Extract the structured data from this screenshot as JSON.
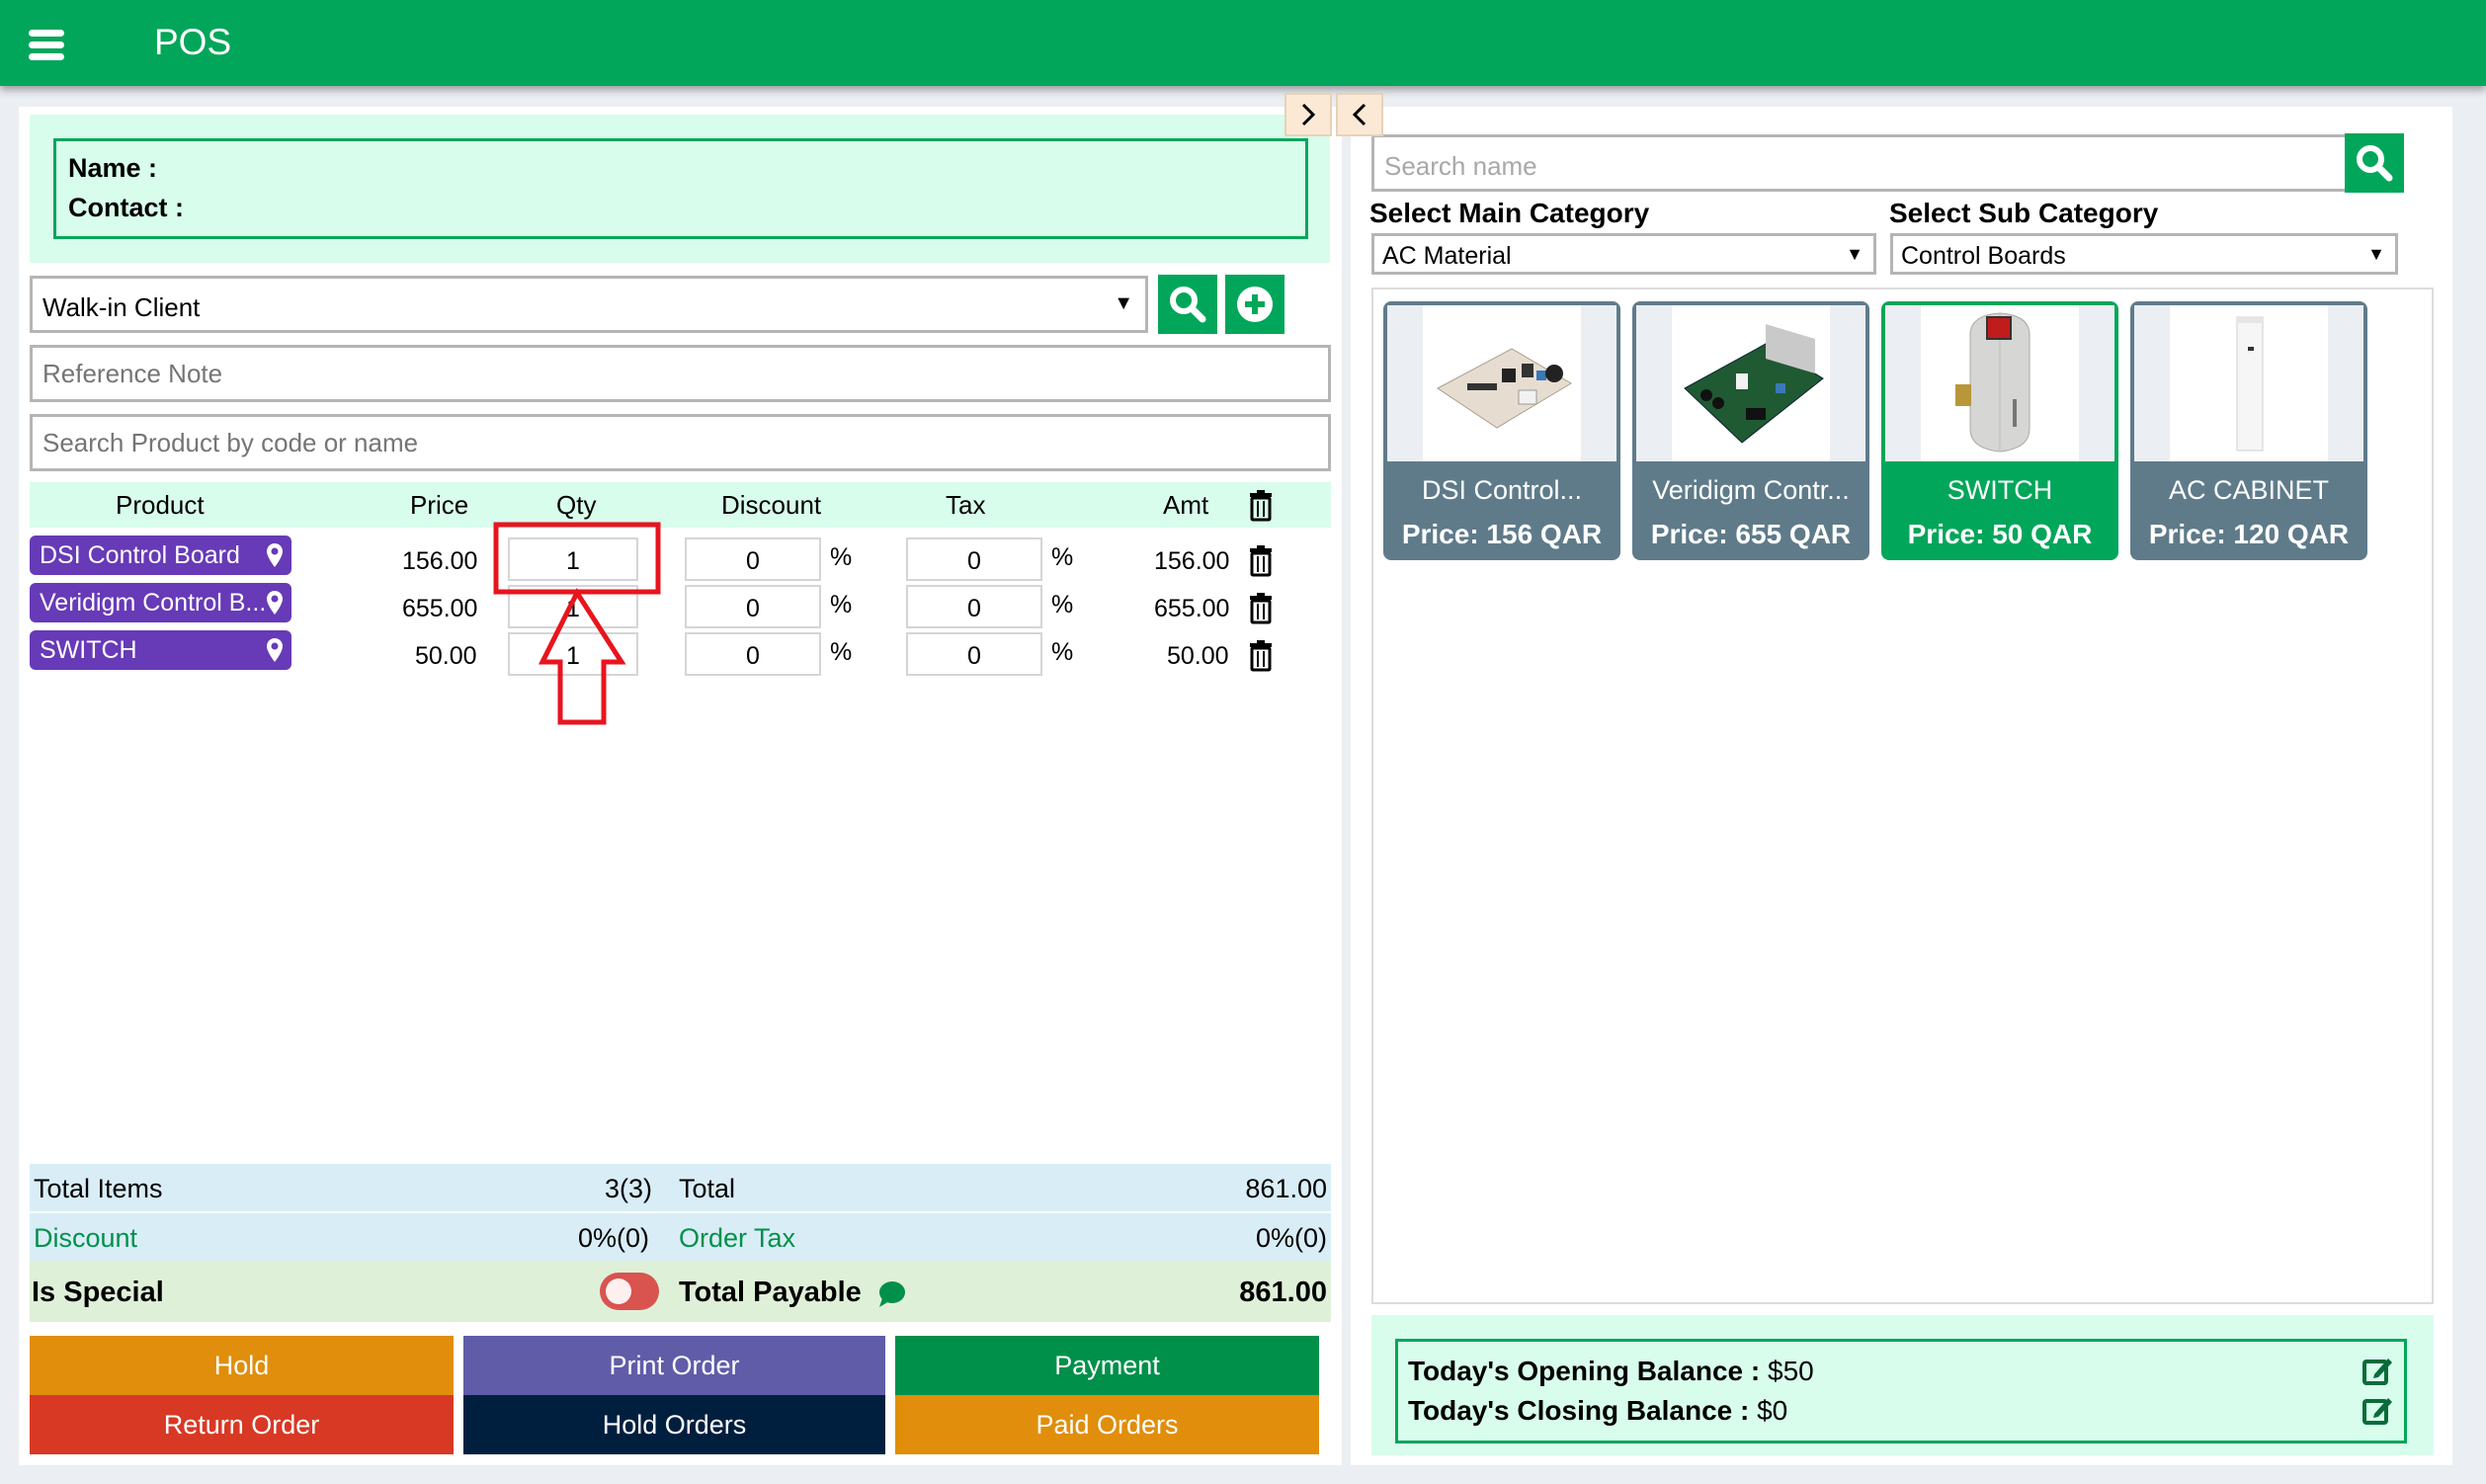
{
  "header": {
    "title": "POS",
    "menu_icon": "hamburger-menu-icon"
  },
  "customer": {
    "name_label": "Name :",
    "name_value": "",
    "contact_label": "Contact :",
    "contact_value": ""
  },
  "client_select": {
    "value": "Walk-in Client"
  },
  "reference_note": {
    "placeholder": "Reference Note",
    "value": ""
  },
  "product_search": {
    "placeholder": "Search Product by code or name",
    "value": ""
  },
  "table": {
    "headers": {
      "product": "Product",
      "price": "Price",
      "qty": "Qty",
      "discount": "Discount",
      "tax": "Tax",
      "amt": "Amt"
    },
    "rows": [
      {
        "product": "DSI Control Board",
        "price": "156.00",
        "qty": "1",
        "discount": "0",
        "tax": "0",
        "amt": "156.00"
      },
      {
        "product": "Veridigm Control B...",
        "price": "655.00",
        "qty": "1",
        "discount": "0",
        "tax": "0",
        "amt": "655.00"
      },
      {
        "product": "SWITCH",
        "price": "50.00",
        "qty": "1",
        "discount": "0",
        "tax": "0",
        "amt": "50.00"
      }
    ],
    "percent_sign": "%"
  },
  "totals": {
    "total_items_label": "Total Items",
    "total_items_value": "3(3)",
    "total_label": "Total",
    "total_value": "861.00",
    "discount_label": "Discount",
    "discount_value": "0%(0)",
    "order_tax_label": "Order Tax",
    "order_tax_value": "0%(0)",
    "is_special_label": "Is Special",
    "is_special_on": false,
    "total_payable_label": "Total Payable",
    "total_payable_value": "861.00"
  },
  "actions": {
    "hold": "Hold",
    "print_order": "Print Order",
    "payment": "Payment",
    "return_order": "Return Order",
    "hold_orders": "Hold Orders",
    "paid_orders": "Paid Orders"
  },
  "colors": {
    "brand": "#02a65a",
    "hold": "#e08e0b",
    "print": "#605ca8",
    "payment": "#00904a",
    "return": "#d73925",
    "hold_orders": "#001f3f",
    "paid_orders": "#e08e0b",
    "pill": "#673ab7",
    "card": "#5f7b8a",
    "card_selected": "#02a65a"
  },
  "right": {
    "search_placeholder": "Search name",
    "main_category_label": "Select Main Category",
    "main_category_value": "AC Material",
    "sub_category_label": "Select Sub Category",
    "sub_category_value": "Control Boards",
    "products": [
      {
        "name": "DSI Control...",
        "price": "Price: 156 QAR",
        "selected": false
      },
      {
        "name": "Veridigm Contr...",
        "price": "Price: 655 QAR",
        "selected": false
      },
      {
        "name": "SWITCH",
        "price": "Price: 50 QAR",
        "selected": true
      },
      {
        "name": "AC CABINET",
        "price": "Price: 120 QAR",
        "selected": false
      }
    ],
    "opening_label": "Today's Opening Balance :",
    "opening_value": "$50",
    "closing_label": "Today's Closing Balance :",
    "closing_value": "$0"
  }
}
